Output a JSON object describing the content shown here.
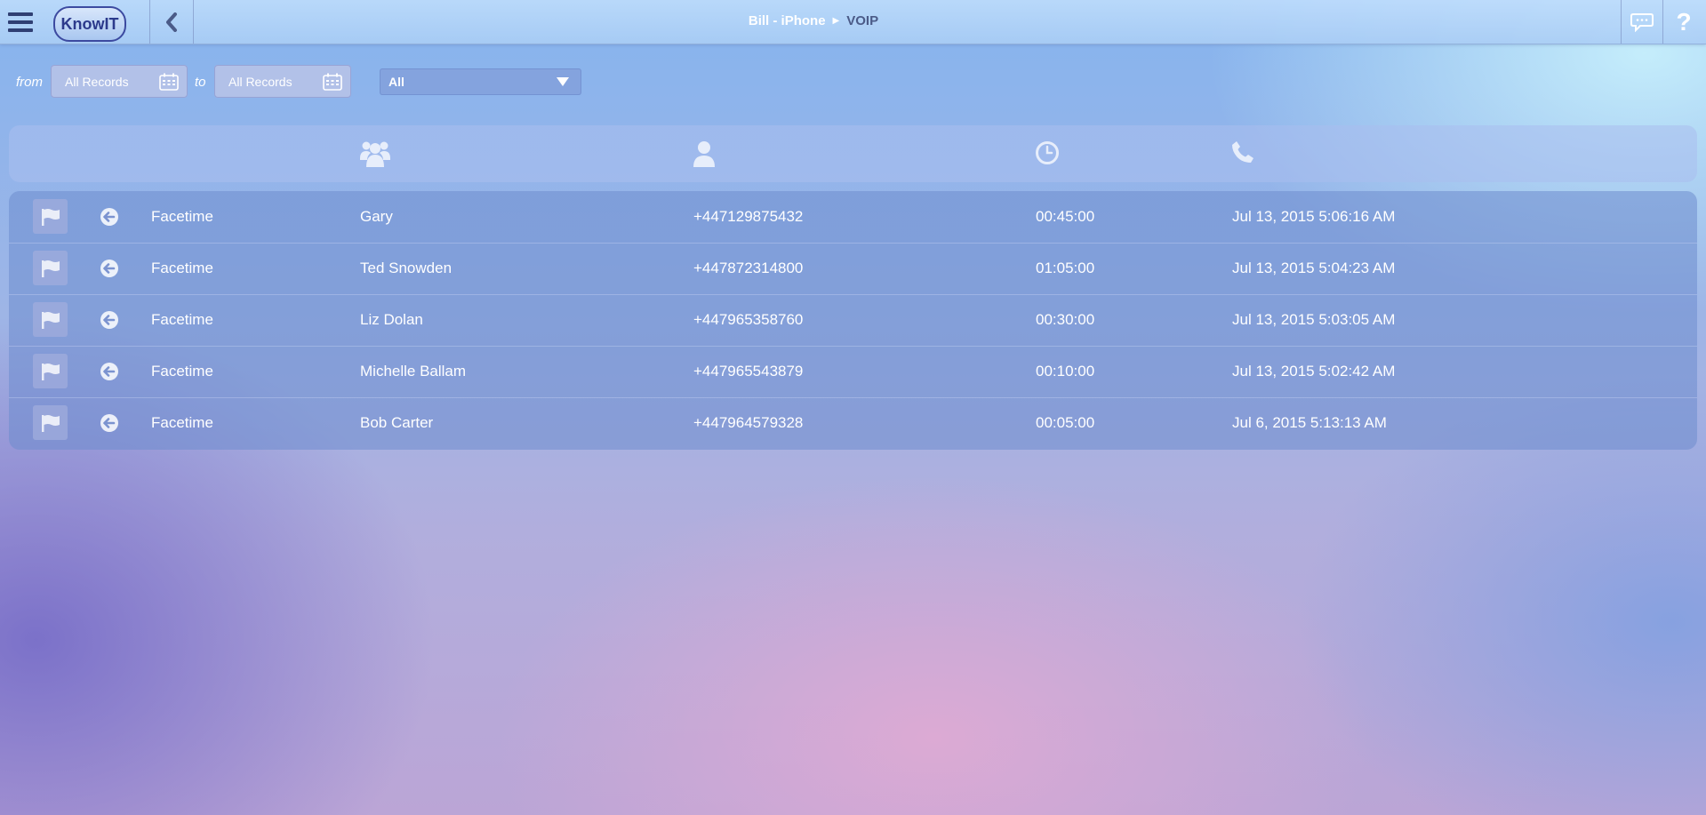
{
  "header": {
    "logo_text": "KnowIT",
    "breadcrumb": [
      "Bill - iPhone",
      "VOIP"
    ]
  },
  "filters": {
    "from_label": "from",
    "from_value": "All Records",
    "to_label": "to",
    "to_value": "All Records",
    "type_value": "All"
  },
  "columns": {
    "icons": [
      "contacts-icon",
      "user-icon",
      "clock-icon",
      "phone-icon"
    ]
  },
  "rows": [
    {
      "type": "Facetime",
      "name": "Gary",
      "number": "+447129875432",
      "duration": "00:45:00",
      "date": "Jul 13, 2015 5:06:16 AM"
    },
    {
      "type": "Facetime",
      "name": "Ted Snowden",
      "number": "+447872314800",
      "duration": "01:05:00",
      "date": "Jul 13, 2015 5:04:23 AM"
    },
    {
      "type": "Facetime",
      "name": "Liz Dolan",
      "number": "+447965358760",
      "duration": "00:30:00",
      "date": "Jul 13, 2015 5:03:05 AM"
    },
    {
      "type": "Facetime",
      "name": "Michelle Ballam",
      "number": "+447965543879",
      "duration": "00:10:00",
      "date": "Jul 13, 2015 5:02:42 AM"
    },
    {
      "type": "Facetime",
      "name": "Bob Carter",
      "number": "+447964579328",
      "duration": "00:05:00",
      "date": "Jul 6, 2015 5:13:13 AM"
    }
  ],
  "colors": {
    "accent_dark": "#2f3f73",
    "text": "#ffffff"
  }
}
